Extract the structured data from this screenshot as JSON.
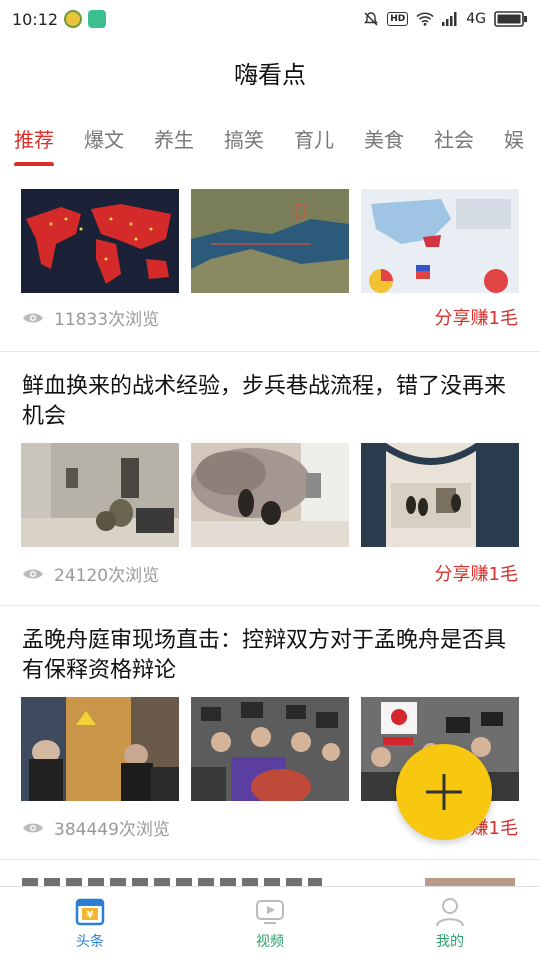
{
  "status_bar": {
    "time": "10:12",
    "network": "4G",
    "hd_badge": "HD"
  },
  "app": {
    "title": "嗨看点"
  },
  "tabs": [
    {
      "label": "推荐",
      "active": true
    },
    {
      "label": "爆文",
      "active": false
    },
    {
      "label": "养生",
      "active": false
    },
    {
      "label": "搞笑",
      "active": false
    },
    {
      "label": "育儿",
      "active": false
    },
    {
      "label": "美食",
      "active": false
    },
    {
      "label": "社会",
      "active": false
    },
    {
      "label": "娱",
      "active": false
    }
  ],
  "articles": [
    {
      "title": "",
      "thumbnails": [
        "world-map-red",
        "strait-satellite-map",
        "crimea-infographic"
      ],
      "views": "11833次浏览",
      "share": "分享赚1毛"
    },
    {
      "title": "鲜血换来的战术经验，步兵巷战流程，错了没再来机会",
      "thumbnails": [
        "soldiers-building",
        "soldiers-smoke",
        "soldiers-arches"
      ],
      "views": "24120次浏览",
      "share": "分享赚1毛"
    },
    {
      "title": "孟晚舟庭审现场直击：控辩双方对于孟晚舟是否具有保释资格辩论",
      "thumbnails": [
        "courtroom-door",
        "press-crowd",
        "protest-signs"
      ],
      "views": "384449次浏览",
      "share": "分享赚1毛"
    }
  ],
  "fab": {
    "icon": "plus-icon"
  },
  "bottom_nav": [
    {
      "label": "头条",
      "icon": "headline-icon",
      "active": true
    },
    {
      "label": "视频",
      "icon": "video-icon",
      "active": false
    },
    {
      "label": "我的",
      "icon": "profile-icon",
      "active": false
    }
  ],
  "colors": {
    "accent_red": "#d9302b",
    "fab_yellow": "#f8c710",
    "nav_blue": "#2a7fd4",
    "nav_green": "#2fa16c"
  }
}
